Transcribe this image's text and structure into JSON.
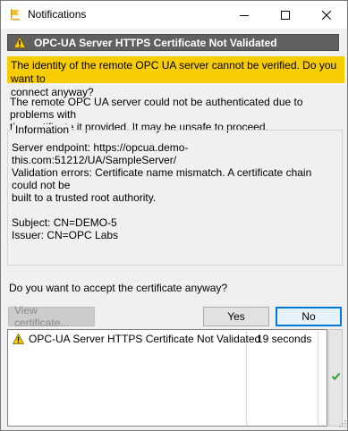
{
  "window": {
    "title": "Notifications",
    "app_icon": "folder-flag-icon"
  },
  "header": {
    "icon": "warning-icon",
    "title": "OPC-UA Server HTTPS Certificate Not Validated"
  },
  "question": {
    "line1": "The identity of the remote OPC UA server cannot be verified. Do you want to",
    "line2": "connect anyway?"
  },
  "description": {
    "line1": "The remote OPC UA server could not be authenticated due to problems with",
    "line2": "the certificate it provided. It may be unsafe to proceed."
  },
  "information": {
    "legend": "Information",
    "line1": "Server endpoint: https://opcua.demo-this.com:51212/UA/SampleServer/",
    "line2": "Validation errors: Certificate name mismatch. A certificate chain could not be",
    "line3": "built to a trusted root authority.",
    "subject": "Subject: CN=DEMO-5",
    "issuer": "Issuer: CN=OPC Labs"
  },
  "prompt": "Do you want to accept the certificate anyway?",
  "buttons": {
    "view_certificate": "View certificate...",
    "yes": "Yes",
    "no": "No"
  },
  "notifications": [
    {
      "icon": "warning-icon",
      "text": "OPC-UA Server HTTPS Certificate Not Validated",
      "time": "19 seconds"
    }
  ],
  "status_icon": "checkmark-icon",
  "colors": {
    "header_bg": "#606060",
    "question_bg": "#f7cc00",
    "default_button_border": "#0078d7",
    "check_green": "#2aa52a"
  }
}
